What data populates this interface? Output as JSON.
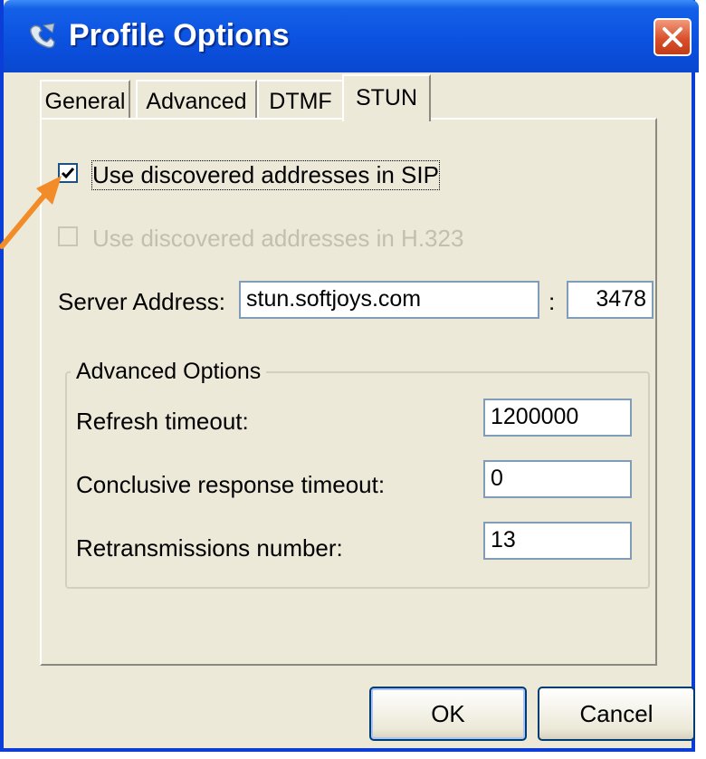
{
  "window": {
    "title": "Profile Options",
    "accent_color": "#0a47cf",
    "icon": "phone-app-icon"
  },
  "tabs": [
    {
      "label": "General",
      "active": false
    },
    {
      "label": "Advanced",
      "active": false
    },
    {
      "label": "DTMF",
      "active": false
    },
    {
      "label": "STUN",
      "active": true
    }
  ],
  "stun": {
    "use_sip": {
      "label": "Use discovered addresses in SIP",
      "checked": true
    },
    "use_h323": {
      "label": "Use discovered addresses in H.323",
      "checked": false,
      "disabled": true
    },
    "server_address": {
      "label": "Server Address:",
      "value": "stun.softjoys.com",
      "separator": ":",
      "port": "3478"
    },
    "advanced_options": {
      "title": "Advanced Options",
      "refresh_timeout": {
        "label": "Refresh timeout:",
        "value": "1200000"
      },
      "conclusive_timeout": {
        "label": "Conclusive response timeout:",
        "value": "0"
      },
      "retransmissions": {
        "label": "Retransmissions number:",
        "value": "13"
      }
    }
  },
  "buttons": {
    "ok": "OK",
    "cancel": "Cancel"
  },
  "annotation": {
    "arrow_color": "#f28c28",
    "icon": "pointer-arrow-icon"
  }
}
